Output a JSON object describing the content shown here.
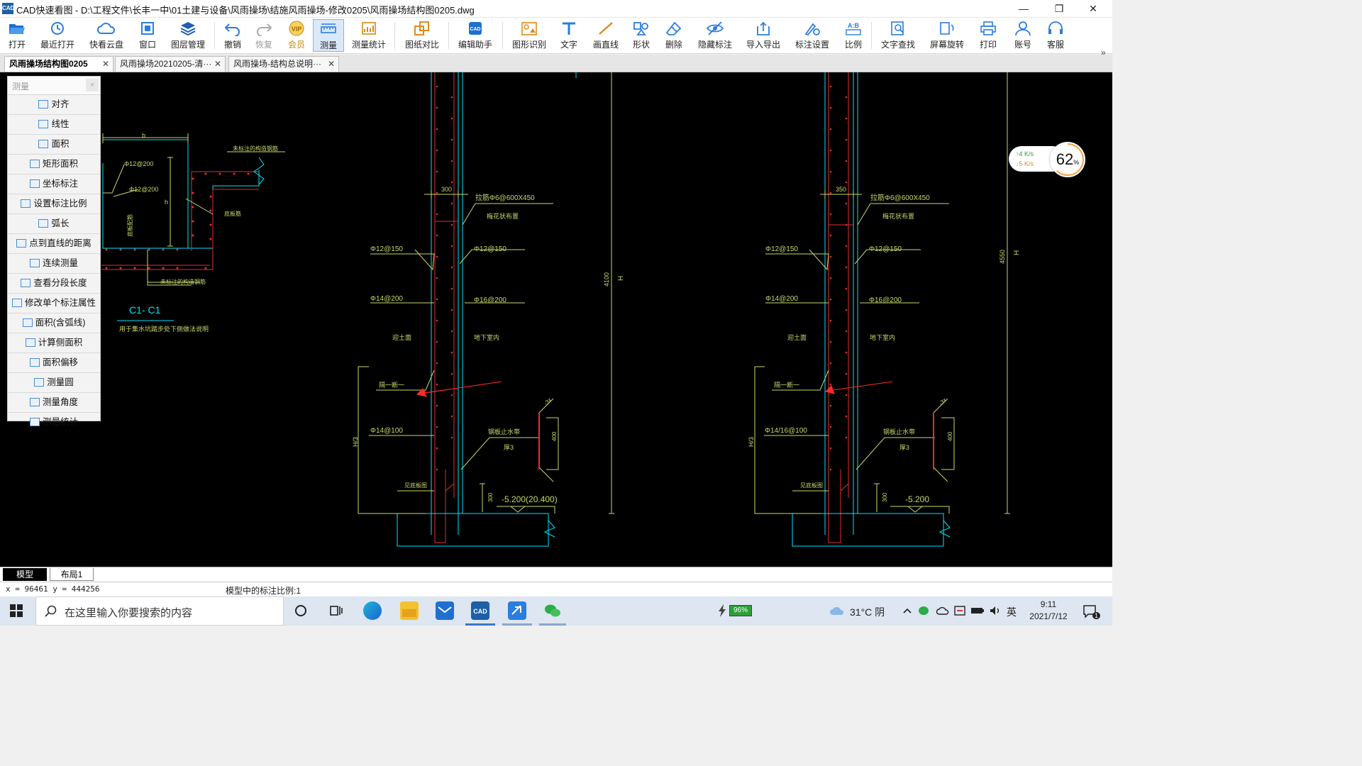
{
  "title_bar": {
    "logo": "CAD",
    "title": "CAD快速看图 - D:\\工程文件\\长丰一中\\01土建与设备\\风雨操场\\结施风雨操场-修改0205\\风雨操场结构图0205.dwg",
    "minimize": "—",
    "restore": "❐",
    "close": "✕"
  },
  "toolbar": {
    "buttons": [
      {
        "label": "打开",
        "icon": "folder-open-icon"
      },
      {
        "label": "最近打开",
        "icon": "recent-icon"
      },
      {
        "label": "快看云盘",
        "icon": "cloud-icon"
      },
      {
        "label": "窗口",
        "icon": "window-icon"
      },
      {
        "label": "图层管理",
        "icon": "layers-icon"
      },
      {
        "label": "撤销",
        "icon": "undo-icon"
      },
      {
        "label": "恢复",
        "icon": "redo-icon"
      },
      {
        "label": "会员",
        "icon": "vip-icon"
      },
      {
        "label": "测量",
        "icon": "measure-icon"
      },
      {
        "label": "测量统计",
        "icon": "measure-stats-icon"
      },
      {
        "label": "图纸对比",
        "icon": "compare-icon"
      },
      {
        "label": "编辑助手",
        "icon": "edit-assistant-icon"
      },
      {
        "label": "图形识别",
        "icon": "shape-recognition-icon"
      },
      {
        "label": "文字",
        "icon": "text-icon"
      },
      {
        "label": "画直线",
        "icon": "line-icon"
      },
      {
        "label": "形状",
        "icon": "shape-icon"
      },
      {
        "label": "删除",
        "icon": "eraser-icon"
      },
      {
        "label": "隐藏标注",
        "icon": "hide-annotation-icon"
      },
      {
        "label": "导入导出",
        "icon": "import-export-icon"
      },
      {
        "label": "标注设置",
        "icon": "annotation-settings-icon"
      },
      {
        "label": "比例",
        "icon": "scale-icon"
      },
      {
        "label": "文字查找",
        "icon": "text-search-icon"
      },
      {
        "label": "屏幕旋转",
        "icon": "screen-rotate-icon"
      },
      {
        "label": "打印",
        "icon": "print-icon"
      },
      {
        "label": "账号",
        "icon": "account-icon"
      },
      {
        "label": "客服",
        "icon": "customer-service-icon"
      }
    ],
    "more": "»"
  },
  "tabs": [
    {
      "label": "风雨操场结构图0205",
      "active": true
    },
    {
      "label": "风雨操场20210205-清···",
      "active": false
    },
    {
      "label": "风雨操场-结构总说明···",
      "active": false
    }
  ],
  "tab_close": "✕",
  "measure_panel": {
    "title": "测量",
    "close": "×",
    "items": [
      "对齐",
      "线性",
      "面积",
      "矩形面积",
      "坐标标注",
      "设置标注比例",
      "弧长",
      "点到直线的距离",
      "连续测量",
      "查看分段长度",
      "修改单个标注属性",
      "面积(含弧线)",
      "计算侧面积",
      "面积偏移",
      "测量圆",
      "测量角度",
      "测量统计"
    ]
  },
  "drawing": {
    "section_title": "C1- C1",
    "section_note": "用于集水坑踏步处下侧做法说明",
    "detail_labels": {
      "b": "b",
      "h": "h",
      "top_note": "未标注的构造钢筋",
      "bottom_note": "未标注的构造钢筋",
      "rebar1": "Φ12@200",
      "rebar2": "Φ12@200",
      "side_note": "底板筋",
      "center_note": "底板配筋"
    },
    "left_detail": {
      "dim_width": "300",
      "tie": "拉筋Φ6@600X450",
      "tie_note": "梅花状布置",
      "left_top": "Φ12@150",
      "right_top": "Φ12@150",
      "left_mid": "Φ14@200",
      "right_mid": "Φ16@200",
      "soil_side": "迎土面",
      "indoor": "地下室内",
      "spacer": "隔一断一",
      "left_bottom": "Φ14@100",
      "waterstop": "钢板止水带",
      "thickness": "厚3",
      "ws_dim": "400",
      "base_note": "见底板图",
      "base_dim": "300",
      "elevation": "-5.200(20.400)",
      "h3": "H/3",
      "height": "4100",
      "h": "H",
      "ws_size": "-3x"
    },
    "right_detail": {
      "dim_width": "350",
      "tie": "拉筋Φ6@600X450",
      "tie_note": "梅花状布置",
      "left_top": "Φ12@150",
      "right_top": "Φ12@150",
      "left_mid": "Φ14@200",
      "right_mid": "Φ16@200",
      "soil_side": "迎土面",
      "indoor": "地下室内",
      "spacer": "隔一断一",
      "left_bottom": "Φ14/16@100",
      "waterstop": "钢板止水带",
      "thickness": "厚3",
      "ws_dim": "400",
      "base_note": "见底板图",
      "base_dim": "300",
      "elevation": "-5.200",
      "h3": "H/3",
      "height": "4550",
      "h": "H",
      "ws_size": "-3x"
    }
  },
  "speed_widget": {
    "up": "↑4  K/s",
    "down": "↓5  K/s",
    "percent": "62",
    "percent_sign": "%"
  },
  "layout_tabs": [
    {
      "label": "模型",
      "active": true
    },
    {
      "label": "布局1",
      "active": false
    }
  ],
  "status_bar": {
    "coordinates": "x = 96461  y = 444256",
    "scale_info": "模型中的标注比例:1"
  },
  "taskbar": {
    "search_placeholder": "在这里输入你要搜索的内容",
    "battery": "96%",
    "weather": "31°C  阴",
    "ime": "英",
    "time": "9:11",
    "date": "2021/7/12",
    "notifications": "1"
  },
  "colors": {
    "canvas_bg": "#000000",
    "cad_cyan": "#00e5ff",
    "cad_red": "#e03030",
    "cad_yellow_green": "#c8d86a",
    "annotation_arrow": "#ff2a2a"
  }
}
